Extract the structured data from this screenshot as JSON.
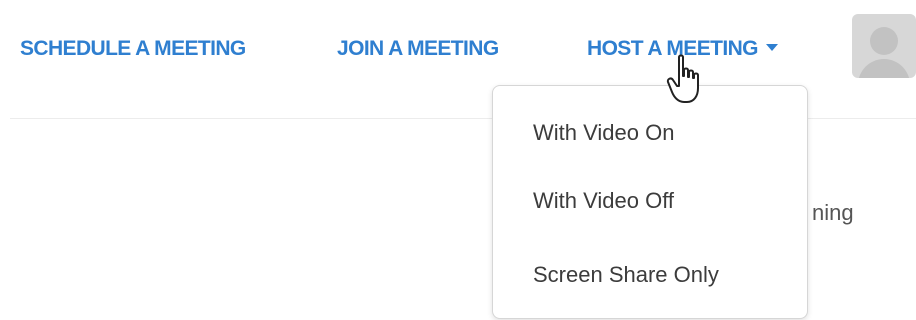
{
  "nav": {
    "schedule_label": "SCHEDULE A MEETING",
    "join_label": "JOIN A MEETING",
    "host_label": "HOST A MEETING"
  },
  "background_text": "ning",
  "host_menu": {
    "items": [
      {
        "label": "With Video On"
      },
      {
        "label": "With Video Off"
      },
      {
        "label": "Screen Share Only"
      }
    ]
  },
  "icons": {
    "caret": "chevron-down-icon",
    "avatar": "user-avatar-icon",
    "cursor": "hand-pointer-cursor-icon"
  },
  "colors": {
    "link": "#2f7fd0",
    "menu_text": "#3c3c3c",
    "avatar_bg": "#d7d7d7"
  }
}
